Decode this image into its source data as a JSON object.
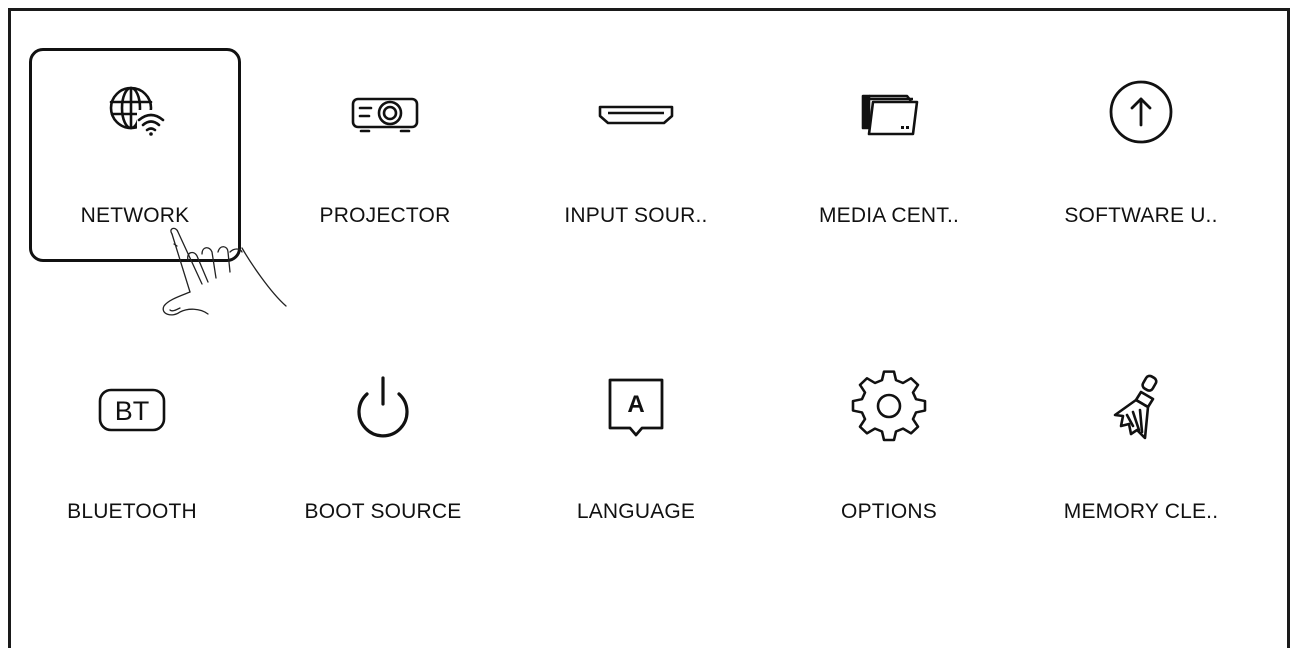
{
  "menu": {
    "items": [
      {
        "label": "NETWORK",
        "icon": "globe-wifi-icon",
        "selected": true
      },
      {
        "label": "PROJECTOR",
        "icon": "projector-icon",
        "selected": false
      },
      {
        "label": "INPUT SOUR..",
        "icon": "hdmi-port-icon",
        "selected": false
      },
      {
        "label": "MEDIA CENT..",
        "icon": "folders-icon",
        "selected": false
      },
      {
        "label": "SOFTWARE U..",
        "icon": "upload-arrow-icon",
        "selected": false
      },
      {
        "label": "BLUETOOTH",
        "icon": "bt-icon",
        "selected": false,
        "icon_text": "BT"
      },
      {
        "label": "BOOT SOURCE",
        "icon": "power-icon",
        "selected": false
      },
      {
        "label": "LANGUAGE",
        "icon": "language-icon",
        "selected": false,
        "icon_text": "A"
      },
      {
        "label": "OPTIONS",
        "icon": "gear-icon",
        "selected": false
      },
      {
        "label": "MEMORY CLE..",
        "icon": "broom-icon",
        "selected": false
      }
    ]
  },
  "colors": {
    "ink": "#111111",
    "background": "#ffffff"
  }
}
